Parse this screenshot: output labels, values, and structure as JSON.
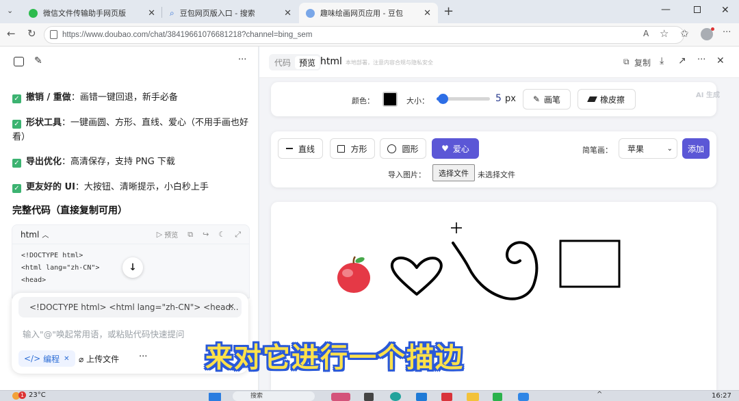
{
  "tabs": [
    {
      "title": "微信文件传输助手网页版",
      "icon": "wechat-icon"
    },
    {
      "title": "豆包网页版入口 - 搜索",
      "icon": "search-icon"
    },
    {
      "title": "趣味绘画网页应用 - 豆包",
      "icon": "doubao-icon"
    }
  ],
  "address": {
    "url": "https://www.doubao.com/chat/38419661076681218?channel=bing_sem"
  },
  "left": {
    "features": [
      {
        "title": "撤销 / 重做",
        "desc": "：画错一键回退，新手必备"
      },
      {
        "title": "形状工具",
        "desc": "：一键画圆、方形、直线、爱心（不用手画也好看）"
      },
      {
        "title": "导出优化",
        "desc": "：高清保存，支持 PNG 下载"
      },
      {
        "title": "更友好的 UI",
        "desc": "：大按钮、清晰提示，小白秒上手"
      }
    ],
    "section_title": "完整代码（直接复制可用）",
    "code": {
      "lang": "html",
      "preview": "预览",
      "lines": [
        "<!DOCTYPE html>",
        "<html lang=\"zh-CN\">",
        "<head>"
      ]
    },
    "snippet": "<!DOCTYPE html> <html lang=\"zh-CN\"> <head...",
    "input_placeholder": "输入\"@\"唤起常用语，或粘贴代码快速提问",
    "tag_coding": "编程",
    "upload": "上传文件",
    "more": "···"
  },
  "right": {
    "tab_code": "代码",
    "tab_preview": "预览",
    "title": "html",
    "subtitle": "本地部署，注意内容合规与隐私安全",
    "copy": "复制",
    "ai_badge": "AI 生成",
    "toolbar": {
      "color_label": "颜色：",
      "color_value": "#000000",
      "size_label": "大小：",
      "size_value": "5",
      "size_fraction": 0.12,
      "size_unit": "px",
      "brush": "画笔",
      "eraser": "橡皮擦"
    },
    "shapes": {
      "line": "直线",
      "square": "方形",
      "circle": "圆形",
      "heart": "爱心",
      "stick_label": "简笔画：",
      "stick_value": "苹果",
      "add": "添加",
      "import_label": "导入图片：",
      "choose_file": "选择文件",
      "no_file": "未选择文件"
    }
  },
  "caption": "来对它进行一个描边",
  "taskbar": {
    "temp": "23°C",
    "time": "16:27",
    "search": "搜索",
    "weather_badge": "1"
  },
  "colors": {
    "accent": "#5b57d6",
    "check": "#3cb371",
    "caption_fill": "#ffe14a",
    "caption_stroke": "#2a59d8"
  }
}
